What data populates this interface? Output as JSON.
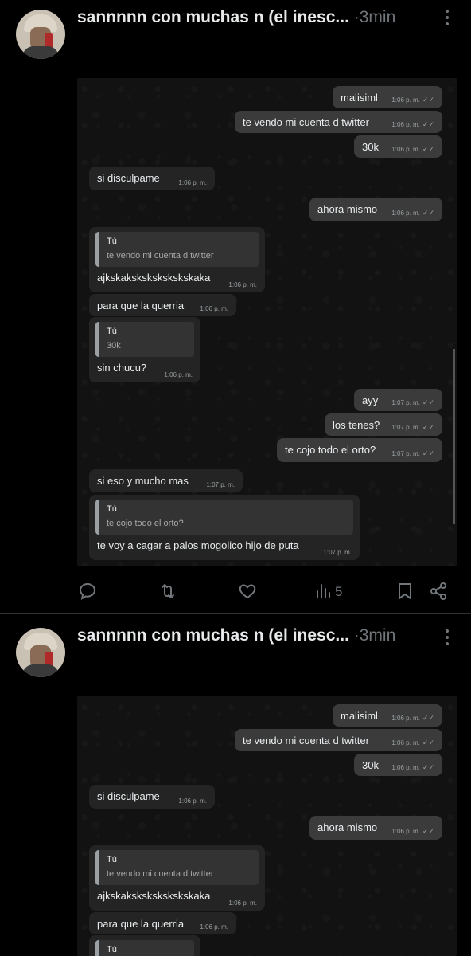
{
  "posts": [
    {
      "author_name": "sannnnn con muchas n (el inesc...",
      "separator": "·",
      "time": "3min",
      "views": "5",
      "messages": [
        {
          "dir": "out",
          "text": "malisiml",
          "time": "1:06 p. m.",
          "ticks": "✓✓"
        },
        {
          "dir": "out",
          "text": "te vendo mi cuenta d twitter",
          "time": "1:06 p. m.",
          "ticks": "✓✓"
        },
        {
          "dir": "out",
          "text": "30k",
          "time": "1:06 p. m.",
          "ticks": "✓✓"
        },
        {
          "dir": "in",
          "text": "si disculpame",
          "time": "1:06 p. m."
        },
        {
          "dir": "out",
          "text": "ahora mismo",
          "time": "1:06 p. m.",
          "ticks": "✓✓"
        },
        {
          "dir": "in",
          "quote_name": "Tú",
          "quote_text": "te vendo mi cuenta d twitter",
          "text": "ajkskakskskskskskskaka",
          "time": "1:06 p. m."
        },
        {
          "dir": "in",
          "text": "para que la querria",
          "time": "1:06 p. m."
        },
        {
          "dir": "in",
          "quote_name": "Tú",
          "quote_text": "30k",
          "text": "sin chucu?",
          "time": "1:06 p. m."
        },
        {
          "dir": "out",
          "text": "ayy",
          "time": "1:07 p. m.",
          "ticks": "✓✓"
        },
        {
          "dir": "out",
          "text": "los tenes?",
          "time": "1:07 p. m.",
          "ticks": "✓✓"
        },
        {
          "dir": "out",
          "text": "te cojo todo el orto?",
          "time": "1:07 p. m.",
          "ticks": "✓✓"
        },
        {
          "dir": "in",
          "text": "si eso y mucho mas",
          "time": "1:07 p. m."
        },
        {
          "dir": "in",
          "quote_name": "Tú",
          "quote_text": "te cojo todo el orto?",
          "text": "te voy a cagar a palos mogolico hijo de puta",
          "time": "1:07 p. m."
        }
      ]
    },
    {
      "author_name": "sannnnn con muchas n (el inesc...",
      "separator": "·",
      "time": "3min",
      "messages": [
        {
          "dir": "out",
          "text": "malisiml",
          "time": "1:06 p. m.",
          "ticks": "✓✓"
        },
        {
          "dir": "out",
          "text": "te vendo mi cuenta d twitter",
          "time": "1:06 p. m.",
          "ticks": "✓✓"
        },
        {
          "dir": "out",
          "text": "30k",
          "time": "1:06 p. m.",
          "ticks": "✓✓"
        },
        {
          "dir": "in",
          "text": "si disculpame",
          "time": "1:06 p. m."
        },
        {
          "dir": "out",
          "text": "ahora mismo",
          "time": "1:06 p. m.",
          "ticks": "✓✓"
        },
        {
          "dir": "in",
          "quote_name": "Tú",
          "quote_text": "te vendo mi cuenta d twitter",
          "text": "ajkskakskskskskskskaka",
          "time": "1:06 p. m."
        },
        {
          "dir": "in",
          "text": "para que la querria",
          "time": "1:06 p. m."
        },
        {
          "dir": "in",
          "quote_name": "Tú",
          "quote_text": "",
          "text": "",
          "time": ""
        }
      ]
    }
  ],
  "colors": {
    "accent": "#1d9bf0",
    "muted": "#71767b",
    "bubble_out": "#3b3b3b",
    "bubble_in": "#242424"
  },
  "icons": [
    "reply-icon",
    "repost-icon",
    "like-icon",
    "views-icon",
    "bookmark-icon",
    "share-icon",
    "more-icon"
  ]
}
